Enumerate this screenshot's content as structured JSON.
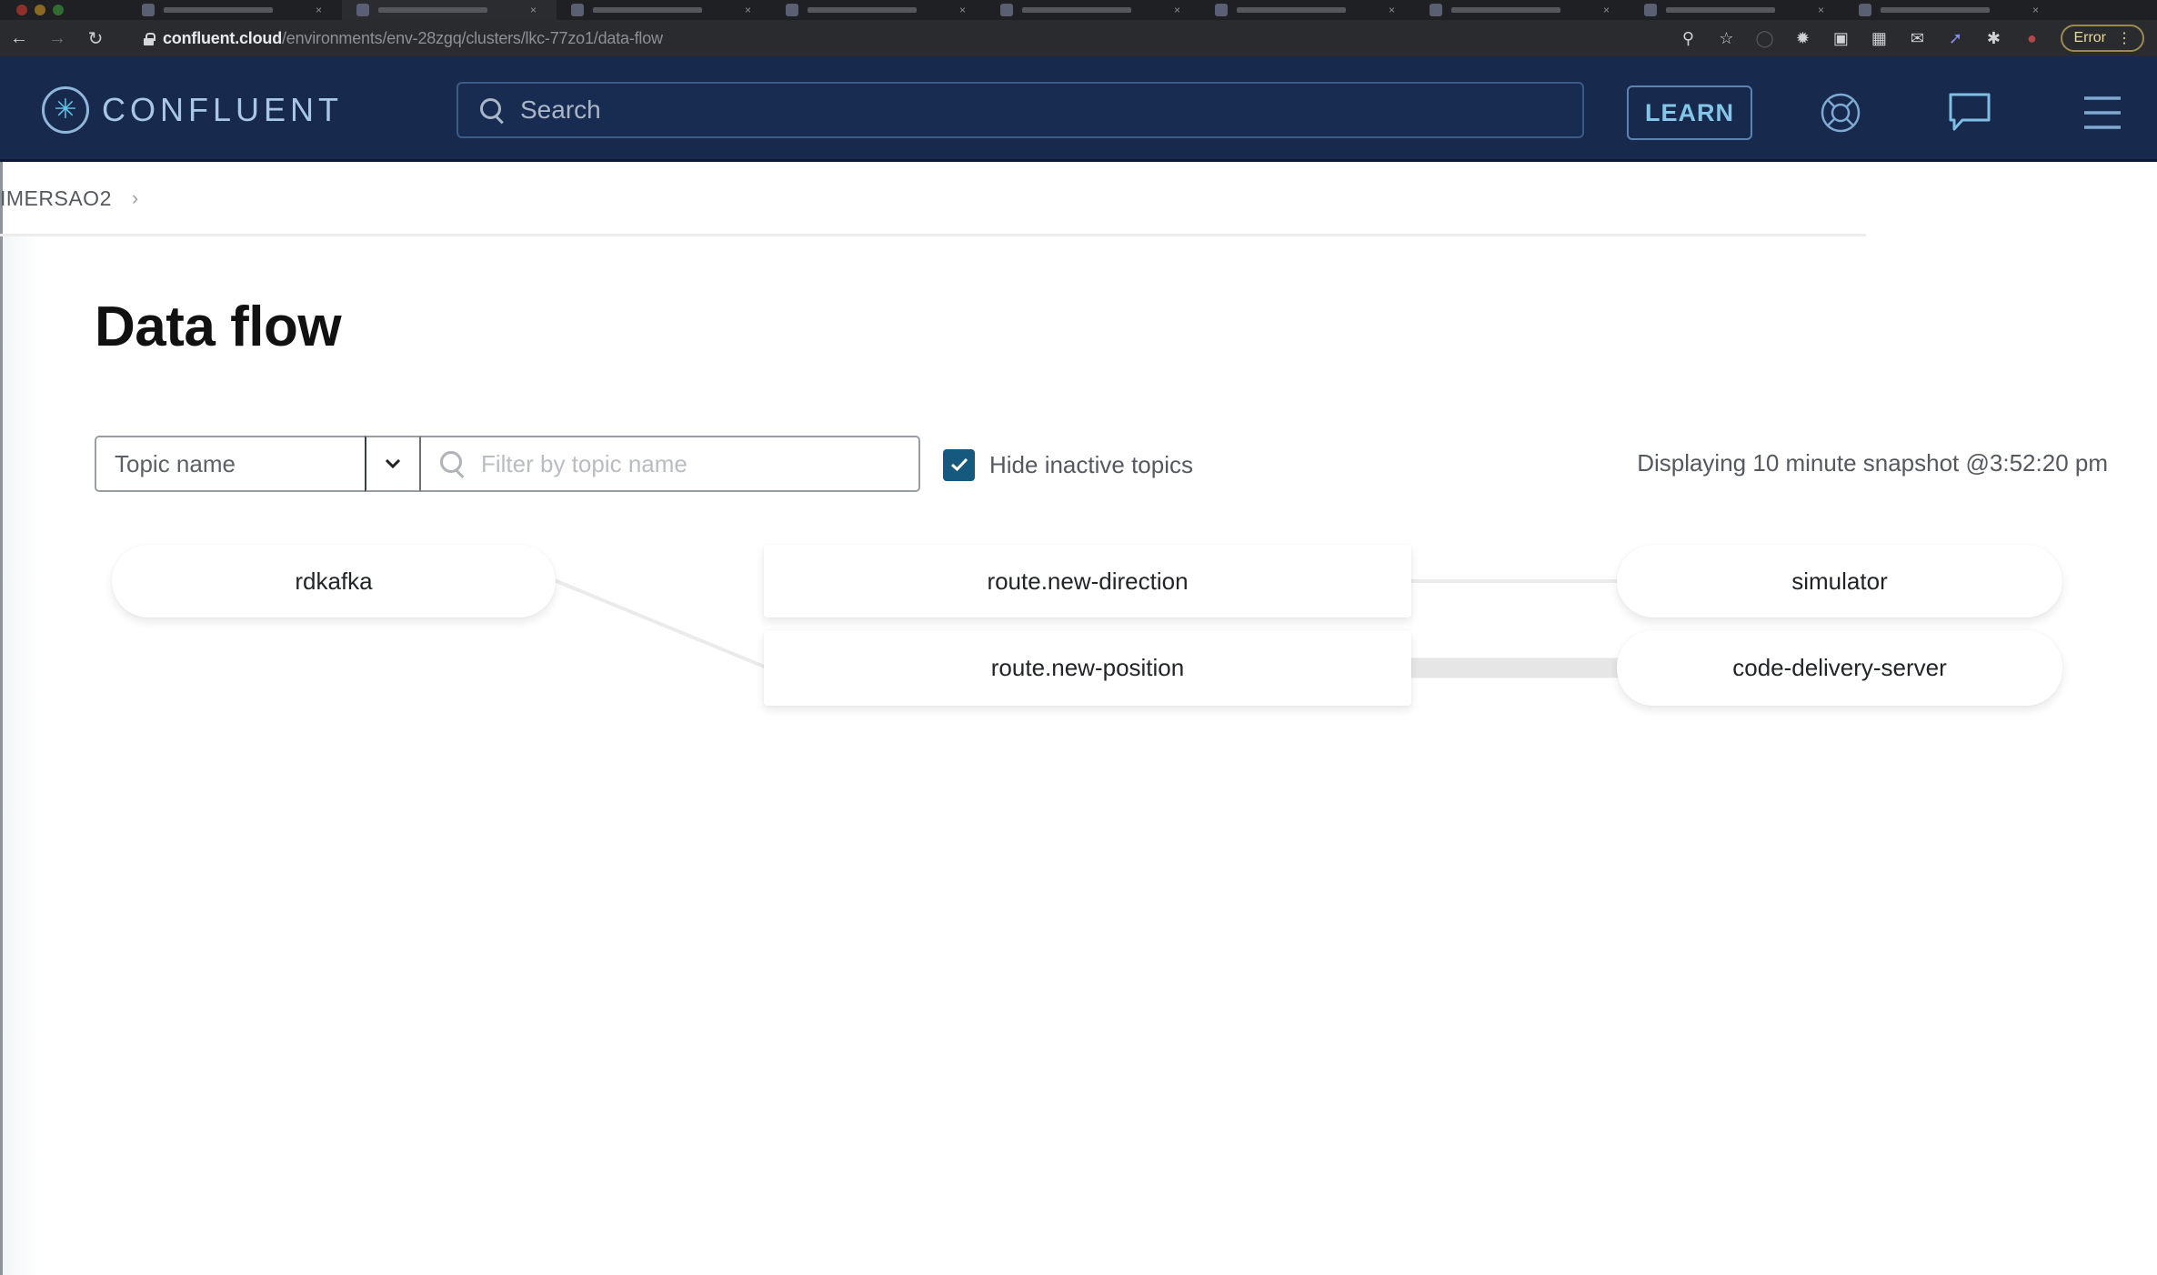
{
  "browser": {
    "tabs": [
      {
        "icon": "confluent-favicon",
        "active": false
      },
      {
        "icon": "confluent-favicon",
        "active": true
      },
      {
        "icon": "shield-favicon",
        "active": false
      },
      {
        "icon": "shield-favicon",
        "active": false
      },
      {
        "icon": "chrome-favicon",
        "active": false
      },
      {
        "icon": "github-favicon",
        "active": false
      },
      {
        "icon": "page-favicon",
        "active": false
      },
      {
        "icon": "green-favicon",
        "active": false
      },
      {
        "icon": "doc-favicon",
        "active": false
      }
    ],
    "url_host": "confluent.cloud",
    "url_path": "/environments/env-28zgq/clusters/lkc-77zo1/data-flow",
    "error_label": "Error"
  },
  "header": {
    "brand": "CONFLUENT",
    "search_placeholder": "Search",
    "learn_label": "LEARN"
  },
  "breadcrumb": {
    "items": [
      "IMERSAO2"
    ],
    "separator": "›"
  },
  "page": {
    "title": "Data flow"
  },
  "filters": {
    "field_select": "Topic name",
    "filter_placeholder": "Filter by topic name",
    "filter_value": "",
    "hide_inactive_label": "Hide inactive topics",
    "hide_inactive_checked": true,
    "snapshot_text": "Displaying 10 minute snapshot @3:52:20 pm"
  },
  "flow": {
    "producers": [
      {
        "name": "rdkafka"
      }
    ],
    "topics": [
      {
        "name": "route.new-direction"
      },
      {
        "name": "route.new-position"
      }
    ],
    "consumers": [
      {
        "name": "simulator"
      },
      {
        "name": "code-delivery-server"
      }
    ],
    "edges": [
      {
        "from": "rdkafka",
        "to": "route.new-position",
        "weight": "thin"
      },
      {
        "from": "route.new-direction",
        "to": "simulator",
        "weight": "thin"
      },
      {
        "from": "route.new-position",
        "to": "code-delivery-server",
        "weight": "thick"
      }
    ],
    "colors": {
      "edge": "#e6e6e6",
      "header_bg": "#172a4d",
      "accent": "#16597e"
    }
  }
}
